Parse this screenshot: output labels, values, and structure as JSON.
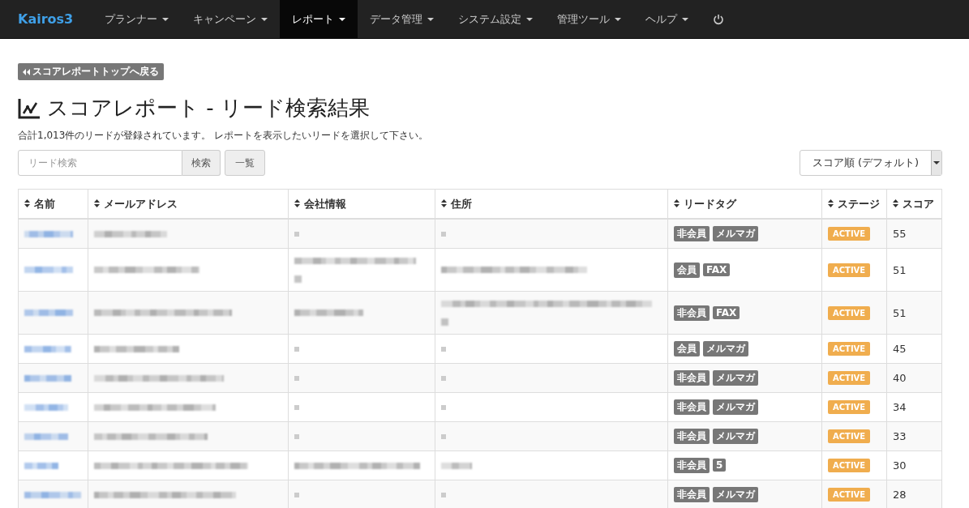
{
  "navbar": {
    "brand": "Kairos3",
    "items": [
      {
        "label": "プランナー",
        "selected": false
      },
      {
        "label": "キャンペーン",
        "selected": false
      },
      {
        "label": "レポート",
        "selected": true
      },
      {
        "label": "データ管理",
        "selected": false
      },
      {
        "label": "システム設定",
        "selected": false
      },
      {
        "label": "管理ツール",
        "selected": false
      },
      {
        "label": "ヘルプ",
        "selected": false
      }
    ]
  },
  "back_button": "スコアレポートトップへ戻る",
  "title": "スコアレポート - リード検索結果",
  "summary": "合計1,013件のリードが登録されています。 レポートを表示したいリードを選択して下さい。",
  "search": {
    "placeholder": "リード検索",
    "button": "検索"
  },
  "list_button": "一覧",
  "sort_select": {
    "value": "スコア順 (デフォルト)"
  },
  "table": {
    "columns": [
      "名前",
      "メールアドレス",
      "会社情報",
      "住所",
      "リードタグ",
      "ステージ",
      "スコア"
    ],
    "rows": [
      {
        "cells": [
          {
            "kind": "blurred"
          },
          {
            "kind": "blurred"
          },
          {
            "kind": "dash"
          },
          {
            "kind": "dash"
          }
        ],
        "tags": [
          "非会員",
          "メルマガ"
        ],
        "stage": "ACTIVE",
        "score": "55"
      },
      {
        "cells": [
          {
            "kind": "blurred"
          },
          {
            "kind": "blurred"
          },
          {
            "kind": "wrapped"
          },
          {
            "kind": "blurred"
          }
        ],
        "tags": [
          "会員",
          "FAX"
        ],
        "stage": "ACTIVE",
        "score": "51"
      },
      {
        "cells": [
          {
            "kind": "blurred"
          },
          {
            "kind": "blurred"
          },
          {
            "kind": "blurred"
          },
          {
            "kind": "wrapped"
          }
        ],
        "tags": [
          "非会員",
          "FAX"
        ],
        "stage": "ACTIVE",
        "score": "51"
      },
      {
        "cells": [
          {
            "kind": "blurred"
          },
          {
            "kind": "blurred"
          },
          {
            "kind": "dash"
          },
          {
            "kind": "dash"
          }
        ],
        "tags": [
          "会員",
          "メルマガ"
        ],
        "stage": "ACTIVE",
        "score": "45"
      },
      {
        "cells": [
          {
            "kind": "blurred"
          },
          {
            "kind": "blurred"
          },
          {
            "kind": "dash"
          },
          {
            "kind": "dash"
          }
        ],
        "tags": [
          "非会員",
          "メルマガ"
        ],
        "stage": "ACTIVE",
        "score": "40"
      },
      {
        "cells": [
          {
            "kind": "blurred"
          },
          {
            "kind": "blurred"
          },
          {
            "kind": "dash"
          },
          {
            "kind": "dash"
          }
        ],
        "tags": [
          "非会員",
          "メルマガ"
        ],
        "stage": "ACTIVE",
        "score": "34"
      },
      {
        "cells": [
          {
            "kind": "blurred"
          },
          {
            "kind": "blurred"
          },
          {
            "kind": "dash"
          },
          {
            "kind": "dash"
          }
        ],
        "tags": [
          "非会員",
          "メルマガ"
        ],
        "stage": "ACTIVE",
        "score": "33"
      },
      {
        "cells": [
          {
            "kind": "blurred"
          },
          {
            "kind": "blurred"
          },
          {
            "kind": "blurred"
          },
          {
            "kind": "blurred"
          }
        ],
        "tags": [
          "非会員",
          "5"
        ],
        "stage": "ACTIVE",
        "score": "30"
      },
      {
        "cells": [
          {
            "kind": "blurred"
          },
          {
            "kind": "blurred"
          },
          {
            "kind": "dash"
          },
          {
            "kind": "dash"
          }
        ],
        "tags": [
          "非会員",
          "メルマガ"
        ],
        "stage": "ACTIVE",
        "score": "28"
      }
    ]
  }
}
